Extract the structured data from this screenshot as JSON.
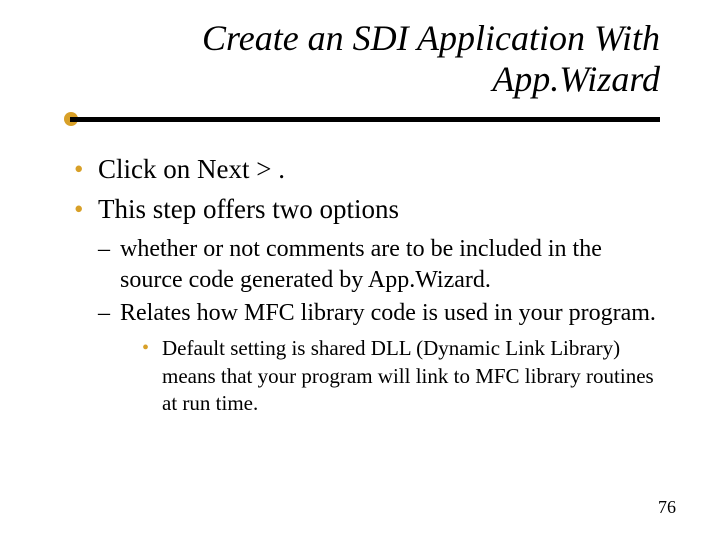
{
  "title_line1": "Create an SDI Application With",
  "title_line2": "App.Wizard",
  "bullets": {
    "b1": "Click on Next > .",
    "b2": "This step offers two options",
    "sub1": "whether or not comments are to be included in the source code generated by App.Wizard.",
    "sub2": "Relates how MFC library code is used in your program.",
    "subsub1": "Default setting is shared DLL (Dynamic Link Library) means that your program will link to MFC library routines at run time."
  },
  "page_number": "76",
  "accent_color": "#d8a028"
}
